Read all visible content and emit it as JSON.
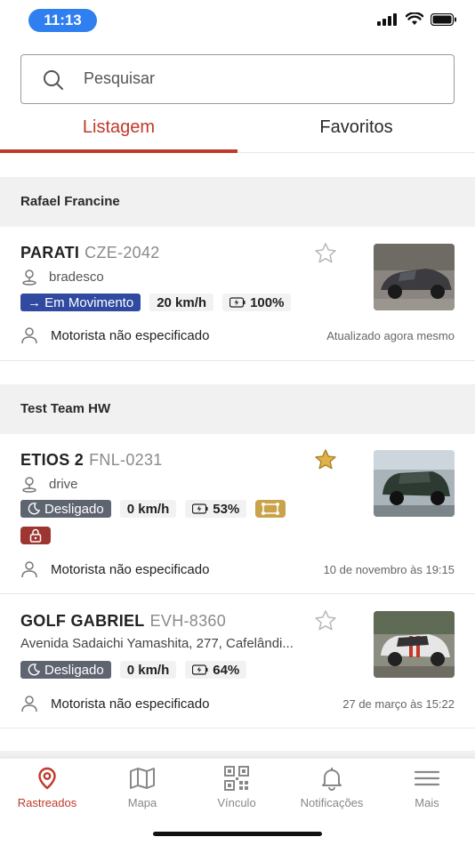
{
  "status_bar": {
    "time": "11:13"
  },
  "search": {
    "placeholder": "Pesquisar"
  },
  "tabs": [
    {
      "label": "Listagem",
      "active": true
    },
    {
      "label": "Favoritos",
      "active": false
    }
  ],
  "groups": [
    {
      "title": "Rafael Francine",
      "vehicles": [
        {
          "name": "PARATI",
          "plate": "CZE-2042",
          "favorite": false,
          "subtitle": "bradesco",
          "status": "→ Em Movimento",
          "speed": "20 km/h",
          "battery": "100%",
          "driver": "Motorista não especificado",
          "updated": "Atualizado agora mesmo",
          "thumb_color": "#3b3b40"
        }
      ]
    },
    {
      "title": "Test Team HW",
      "vehicles": [
        {
          "name": "ETIOS 2",
          "plate": "FNL-0231",
          "favorite": true,
          "subtitle": "drive",
          "status": "Desligado",
          "speed": "0 km/h",
          "battery": "53%",
          "driver": "Motorista não especificado",
          "updated": "10 de novembro às 19:15",
          "thumb_color": "#2c3a32"
        },
        {
          "name": "GOLF GABRIEL",
          "plate": "EVH-8360",
          "favorite": false,
          "subtitle": "Avenida Sadaichi Yamashita, 277, Cafelândi...",
          "status": "Desligado",
          "speed": "0 km/h",
          "battery": "64%",
          "driver": "Motorista não especificado",
          "updated": "27 de março às 15:22",
          "thumb_color": "#d9d9d9"
        }
      ]
    }
  ],
  "bottom_nav": [
    {
      "label": "Rastreados",
      "icon": "location-pin-icon",
      "active": true
    },
    {
      "label": "Mapa",
      "icon": "map-icon",
      "active": false
    },
    {
      "label": "Vínculo",
      "icon": "qr-code-icon",
      "active": false
    },
    {
      "label": "Notificações",
      "icon": "bell-icon",
      "active": false
    },
    {
      "label": "Mais",
      "icon": "menu-icon",
      "active": false
    }
  ],
  "colors": {
    "accent": "#c0392b",
    "moving": "#2f4aa0",
    "off": "#5e6470",
    "favorite": "#e0b34a"
  }
}
